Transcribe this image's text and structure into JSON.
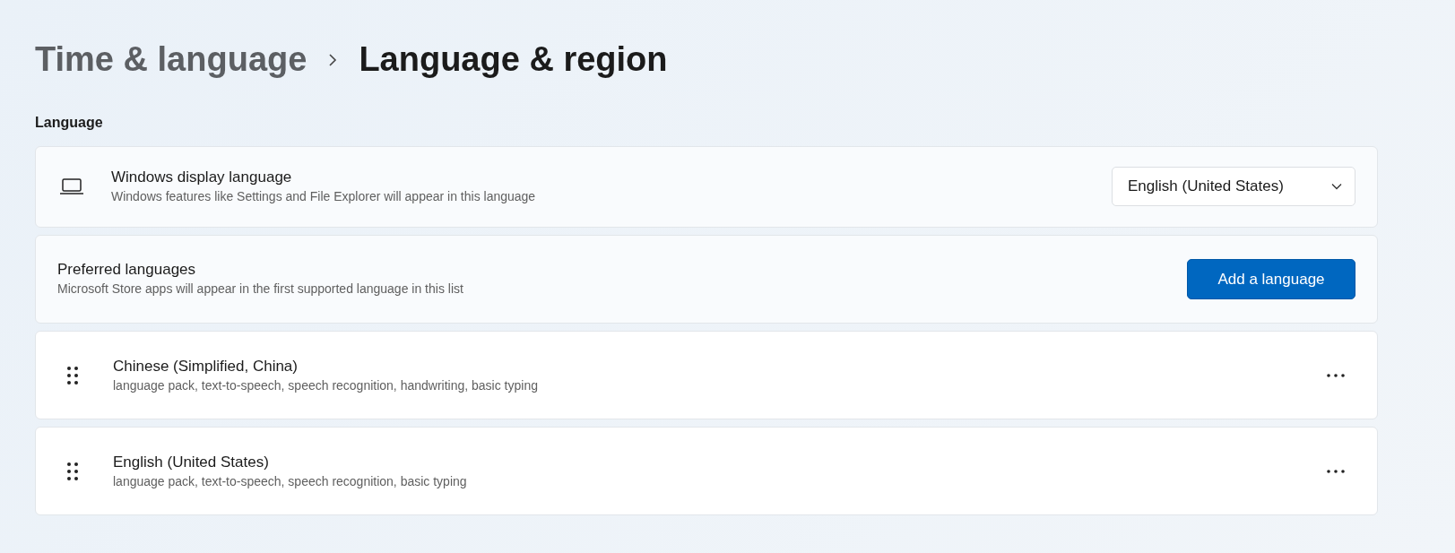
{
  "breadcrumb": {
    "parent": "Time & language",
    "current": "Language & region"
  },
  "section_title": "Language",
  "display_language": {
    "title": "Windows display language",
    "description": "Windows features like Settings and File Explorer will appear in this language",
    "dropdown": {
      "value": "English (United States)"
    }
  },
  "preferred": {
    "title": "Preferred languages",
    "description": "Microsoft Store apps will appear in the first supported language in this list",
    "button": "Add a language"
  },
  "languages": [
    {
      "name": "Chinese (Simplified, China)",
      "features": "language pack, text-to-speech, speech recognition, handwriting, basic typing"
    },
    {
      "name": "English (United States)",
      "features": "language pack, text-to-speech, speech recognition, basic typing"
    }
  ]
}
